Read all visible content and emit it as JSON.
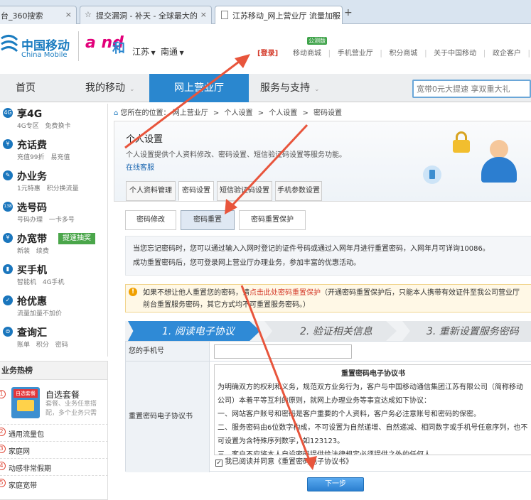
{
  "browser": {
    "tabs": [
      {
        "label": "台_360搜索",
        "close": "×"
      },
      {
        "label": "提交漏洞 - 补天 - 全球最大的",
        "close": "×"
      },
      {
        "label": "江苏移动_网上营业厅 流量加服",
        "close": "×"
      }
    ],
    "new_tab": "+"
  },
  "header": {
    "brand_cn": "中国移动",
    "brand_en": "China Mobile",
    "and_logo": "a nd",
    "and_text": "和",
    "region1": "江苏",
    "region2": "南通",
    "login": "[登录]",
    "badge": "公测版",
    "links": [
      "移动商城",
      "手机营业厅",
      "积分商城",
      "关于中国移动",
      "政企客户",
      "|"
    ]
  },
  "mainnav": {
    "items": [
      "首页",
      "我的移动",
      "网上营业厅",
      "服务与支持"
    ],
    "search_placeholder": "宽带0元大提速 享双重大礼"
  },
  "sidebar": {
    "items": [
      {
        "icon": "4G",
        "title": "享4G",
        "sub": "4G专区 免费换卡"
      },
      {
        "icon": "¥",
        "title": "充话费",
        "sub": "充值99折 易充值"
      },
      {
        "icon": "✎",
        "title": "办业务",
        "sub": "1元特惠 积分换流量"
      },
      {
        "icon": "138",
        "title": "选号码",
        "sub": "号码办理 一卡多号"
      },
      {
        "icon": "¥",
        "title": "办宽带",
        "sub": "新装 续费",
        "promo": "提速抽奖"
      },
      {
        "icon": "▮",
        "title": "买手机",
        "sub": "智能机 4G手机"
      },
      {
        "icon": "✓",
        "title": "抢优惠",
        "sub": "流量加量不加价"
      },
      {
        "icon": "⊜",
        "title": "查询汇",
        "sub": "账单 积分 密码"
      }
    ],
    "hot_title": "业务热榜",
    "hot_feature": {
      "num": "1",
      "title": "自选套餐",
      "desc": "套餐、业务任意搭配，多个业务只需",
      "img_label": "自选套餐"
    },
    "hot_items": [
      {
        "num": "2",
        "label": "通用流量包"
      },
      {
        "num": "3",
        "label": "家庭网"
      },
      {
        "num": "4",
        "label": "动感非常假期"
      },
      {
        "num": "5",
        "label": "家庭宽带"
      }
    ]
  },
  "breadcrumb": {
    "home_icon": "⌂",
    "prefix": "您所在的位置：",
    "path": [
      "网上营业厅",
      "个人设置",
      "个人设置",
      "密码设置"
    ],
    "sep": ">"
  },
  "personal": {
    "title": "个人设置",
    "desc": "个人设置提供个人资料修改、密码设置、短信验证码设置等服务功能。",
    "link": "在线客服",
    "tabs": [
      "个人资料管理",
      "密码设置",
      "短信验证码设置",
      "手机参数设置"
    ]
  },
  "password": {
    "subtabs": [
      "密码修改",
      "密码重置",
      "密码重置保护"
    ],
    "info1": "当您忘记密码时，您可以通过输入入网时登记的证件号码或通过入网年月进行重置密码，入网年月可详询10086。",
    "info2": "成功重置密码后，您可登录网上营业厅办理业务，参加丰富的优惠活动。",
    "warn_pre": "如果不想让他人重置您的密码，请",
    "warn_link": "点击此处密码重置保护",
    "warn_post": "（开通密码重置保护后，只能本人携带有效证件至我公司营业厅前台重置服务密码，其它方式均不可重置服务密码。）",
    "steps": [
      "1. 阅读电子协议",
      "2. 验证相关信息",
      "3. 重新设置服务密码"
    ],
    "phone_label": "您的手机号",
    "agreement_label": "重置密码电子协议书",
    "agreement_title": "重置密码电子协议书",
    "agreement_lines": [
      "为明确双方的权利和义务，规范双方业务行为，客户与中国移动通信集团江苏有限公司（简称移动公司）本着平等互利的原则，就网上办理业务等事宜达成如下协议：",
      "一、网站客户账号和密码是客户重要的个人资料，客户务必注意账号和密码的保密。",
      "二、服务密码由6位数字构成，不可设置为自然递增、自然递减、相同数字或手机号任意序列，也不可设置为含特殊序列数字，如123123。",
      "三、客户不应将本人自设密码提供给法律规定必须提供之外的任何人。"
    ],
    "agree_text": "我已阅读并同意《重置密码电子协议书》",
    "next_button": "下一步"
  }
}
